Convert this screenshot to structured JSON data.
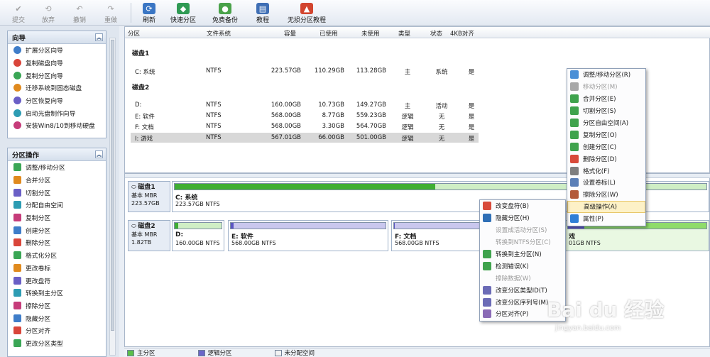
{
  "toolbar": {
    "items": [
      {
        "label": "提交",
        "icon": "check-icon",
        "disabled": true
      },
      {
        "label": "放弃",
        "icon": "discard-icon",
        "disabled": true
      },
      {
        "label": "撤销",
        "icon": "undo-icon",
        "disabled": true
      },
      {
        "label": "重做",
        "icon": "redo-icon",
        "disabled": true
      },
      {
        "label": "刷新",
        "icon": "refresh-icon",
        "disabled": false
      },
      {
        "label": "快速分区",
        "icon": "quick-partition-icon",
        "disabled": false
      },
      {
        "label": "免费备份",
        "icon": "backup-icon",
        "disabled": false
      },
      {
        "label": "教程",
        "icon": "tutorial-icon",
        "disabled": false
      },
      {
        "label": "无损分区教程",
        "icon": "lossless-tutorial-icon",
        "disabled": false
      }
    ]
  },
  "sidebar": {
    "wizard": {
      "title": "向导",
      "items": [
        "扩展分区向导",
        "复制磁盘向导",
        "复制分区向导",
        "迁移系统到固态磁盘",
        "分区恢复向导",
        "启动光盘制作向导",
        "安装Win8/10到移动硬盘"
      ]
    },
    "operations": {
      "title": "分区操作",
      "items": [
        "调整/移动分区",
        "合并分区",
        "切割分区",
        "分配自由空间",
        "复制分区",
        "创建分区",
        "删除分区",
        "格式化分区",
        "更改卷标",
        "更改盘符",
        "转换到主分区",
        "擦除分区",
        "隐藏分区",
        "分区对齐",
        "更改分区类型"
      ]
    }
  },
  "table": {
    "headers": [
      "分区",
      "文件系统",
      "容量",
      "已使用",
      "未使用",
      "类型",
      "状态",
      "4KB对齐"
    ],
    "disks": [
      {
        "label": "磁盘1",
        "rows": [
          {
            "name": "C: 系统",
            "fs": "NTFS",
            "cap": "223.57GB",
            "used": "110.29GB",
            "free": "113.28GB",
            "type": "主",
            "status": "系统",
            "align": "是",
            "selected": false
          }
        ]
      },
      {
        "label": "磁盘2",
        "rows": [
          {
            "name": "D:",
            "fs": "NTFS",
            "cap": "160.00GB",
            "used": "10.73GB",
            "free": "149.27GB",
            "type": "主",
            "status": "活动",
            "align": "是",
            "selected": false
          },
          {
            "name": "E: 软件",
            "fs": "NTFS",
            "cap": "568.00GB",
            "used": "8.77GB",
            "free": "559.23GB",
            "type": "逻辑",
            "status": "无",
            "align": "是",
            "selected": false
          },
          {
            "name": "F: 文档",
            "fs": "NTFS",
            "cap": "568.00GB",
            "used": "3.30GB",
            "free": "564.70GB",
            "type": "逻辑",
            "status": "无",
            "align": "是",
            "selected": false
          },
          {
            "name": "I: 游戏",
            "fs": "NTFS",
            "cap": "567.01GB",
            "used": "66.00GB",
            "free": "501.00GB",
            "type": "逻辑",
            "status": "无",
            "align": "是",
            "selected": true
          }
        ]
      }
    ]
  },
  "diskmap": {
    "disk1": {
      "name": "磁盘1",
      "type": "基本 MBR",
      "size": "223.57GB",
      "parts": [
        {
          "name": "C: 系统",
          "info": "223.57GB NTFS",
          "usage": 0.49,
          "kind": "primary"
        }
      ]
    },
    "disk2": {
      "name": "磁盘2",
      "type": "基本 MBR",
      "size": "1.82TB",
      "parts": [
        {
          "name": "D:",
          "info": "160.00GB NTFS",
          "usage": 0.07,
          "kind": "primary"
        },
        {
          "name": "E: 软件",
          "info": "568.00GB NTFS",
          "usage": 0.02,
          "kind": "logical"
        },
        {
          "name": "F: 文档",
          "info": "568.00GB NTFS",
          "usage": 0.01,
          "kind": "logical"
        },
        {
          "name": "戏",
          "info": "01GB NTFS",
          "usage": 0.12,
          "kind": "logical"
        }
      ]
    }
  },
  "legend": [
    {
      "label": "主分区",
      "color": "#5bbf4a"
    },
    {
      "label": "逻辑分区",
      "color": "#6b66c9"
    },
    {
      "label": "未分配空间",
      "color": "#f2f2f2"
    }
  ],
  "menu_right": {
    "items": [
      {
        "label": "调整/移动分区(R)",
        "icon": "resize-icon",
        "disabled": false
      },
      {
        "label": "移动分区(M)",
        "icon": "move-icon",
        "disabled": true
      },
      {
        "label": "合并分区(E)",
        "icon": "merge-icon",
        "disabled": false
      },
      {
        "label": "切割分区(S)",
        "icon": "split-icon",
        "disabled": false
      },
      {
        "label": "分区自由空间(A)",
        "icon": "allocate-icon",
        "disabled": false
      },
      {
        "label": "复制分区(O)",
        "icon": "copy-icon",
        "disabled": false
      },
      {
        "label": "创建分区(C)",
        "icon": "create-icon",
        "disabled": false
      },
      {
        "label": "删除分区(D)",
        "icon": "delete-icon",
        "disabled": false
      },
      {
        "label": "格式化(F)",
        "icon": "format-icon",
        "disabled": false
      },
      {
        "label": "设置卷标(L)",
        "icon": "label-icon",
        "disabled": false
      },
      {
        "label": "擦除分区(W)",
        "icon": "wipe-icon",
        "disabled": false
      },
      {
        "label": "高级操作(A)",
        "icon": "",
        "disabled": false,
        "highlighted": true
      },
      {
        "label": "属性(P)",
        "icon": "info-icon",
        "disabled": false
      }
    ]
  },
  "menu_sub": {
    "items": [
      {
        "label": "改变盘符(B)",
        "icon": "drive-letter-icon",
        "disabled": false
      },
      {
        "label": "隐藏分区(H)",
        "icon": "hide-icon",
        "disabled": false
      },
      {
        "label": "设置成活动分区(S)",
        "icon": "",
        "disabled": true
      },
      {
        "label": "转换到NTFS分区(C)",
        "icon": "",
        "disabled": true
      },
      {
        "label": "转换到主分区(N)",
        "icon": "convert-icon",
        "disabled": false
      },
      {
        "label": "检测错误(K)",
        "icon": "check-error-icon",
        "disabled": false
      },
      {
        "label": "擦除数据(W)",
        "icon": "",
        "disabled": true
      },
      {
        "label": "改变分区类型ID(T)",
        "icon": "type-id-icon",
        "disabled": false
      },
      {
        "label": "改变分区序列号(M)",
        "icon": "serial-icon",
        "disabled": false
      },
      {
        "label": "分区对齐(P)",
        "icon": "align-icon",
        "disabled": false
      }
    ]
  },
  "watermark": {
    "brand": "Bai du 经验",
    "url": "jingyan.baidu.com"
  }
}
